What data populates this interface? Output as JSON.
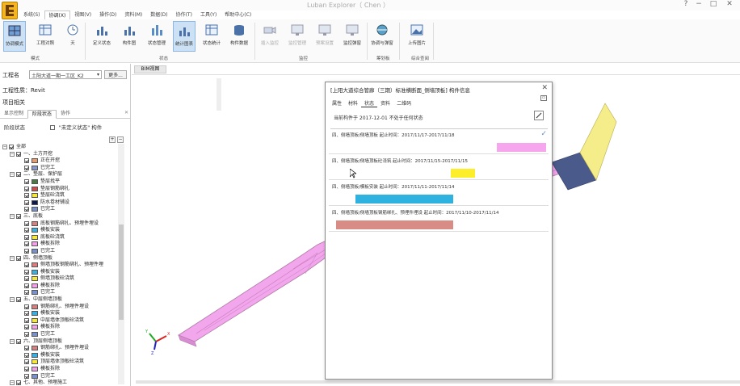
{
  "app": {
    "title": "Luban Explorer（ Chen ）",
    "window_controls": [
      "?",
      "−",
      "□",
      "✕"
    ]
  },
  "menu": [
    "系统(S)",
    "协调(X)",
    "视图(V)",
    "操作(D)",
    "资料(M)",
    "数据(D)",
    "协作(T)",
    "工具(Y)",
    "帮助中心(C)"
  ],
  "menu_active_index": 1,
  "ribbon": {
    "buttons": [
      {
        "label": "协调模式",
        "icon": "grid-icon",
        "selected": true,
        "dim": false
      },
      {
        "label": "工程对照",
        "icon": "table-icon",
        "selected": false,
        "dim": false
      },
      {
        "label": "天",
        "icon": "clock-icon",
        "selected": false,
        "dim": false
      },
      {
        "label": "定义状态",
        "icon": "chart-icon",
        "selected": false,
        "dim": false
      },
      {
        "label": "构件图",
        "icon": "chart-icon",
        "selected": false,
        "dim": false
      },
      {
        "label": "状态管理",
        "icon": "bars-icon",
        "selected": false,
        "dim": false
      },
      {
        "label": "统计图表",
        "icon": "chart-icon",
        "selected": true,
        "dim": false
      },
      {
        "label": "状态统计",
        "icon": "table-icon",
        "selected": false,
        "dim": false
      },
      {
        "label": "构件数据",
        "icon": "database-icon",
        "selected": false,
        "dim": false
      },
      {
        "label": "插入监控",
        "icon": "camera-icon",
        "selected": false,
        "dim": true
      },
      {
        "label": "监控管理",
        "icon": "monitor-icon",
        "selected": false,
        "dim": true
      },
      {
        "label": "预案设置",
        "icon": "monitor-icon",
        "selected": false,
        "dim": true
      },
      {
        "label": "监控弹窗",
        "icon": "monitor-icon",
        "selected": false,
        "dim": false
      },
      {
        "label": "协调与弹窗",
        "icon": "globe-icon",
        "selected": false,
        "dim": false
      },
      {
        "label": "上传图片",
        "icon": "image-icon",
        "selected": false,
        "dim": false
      }
    ],
    "groups": [
      "模式",
      "状态",
      "监控",
      "筹划板",
      "综合查阅"
    ]
  },
  "left_panel": {
    "project_label": "工程名",
    "project_value": "土阳大道一期一工区_K2",
    "more_button": "更多...",
    "project_property": "工程性质：Revit",
    "project_related": "项目相关",
    "tabs": [
      "显示控制",
      "阶段状态",
      "协作"
    ],
    "active_tab_index": 1,
    "filter_label": "阶段状态",
    "filter_option": "\"未定义状态\" 构件",
    "tree": [
      {
        "level": 0,
        "label": "全部",
        "color": "",
        "expander": "−"
      },
      {
        "level": 1,
        "label": "一、土方开挖",
        "color": "",
        "expander": "−"
      },
      {
        "level": 2,
        "label": "正在开挖",
        "color": "#e89a6a",
        "expander": ""
      },
      {
        "level": 2,
        "label": "已完工",
        "color": "#8899c8",
        "expander": ""
      },
      {
        "level": 1,
        "label": "二、垫层、保护层",
        "color": "",
        "expander": "−"
      },
      {
        "level": 2,
        "label": "垫层找平",
        "color": "#4a7a44",
        "expander": ""
      },
      {
        "level": 2,
        "label": "垫层钢筋绑扎",
        "color": "#c85050",
        "expander": ""
      },
      {
        "level": 2,
        "label": "垫层砼浇筑",
        "color": "#f5e83a",
        "expander": ""
      },
      {
        "level": 2,
        "label": "防水卷材铺设",
        "color": "#101850",
        "expander": ""
      },
      {
        "level": 2,
        "label": "已完工",
        "color": "#7a90c8",
        "expander": ""
      },
      {
        "level": 1,
        "label": "三、底板",
        "color": "",
        "expander": "−"
      },
      {
        "level": 2,
        "label": "底板钢筋绑扎、预埋件埋设",
        "color": "#d88080",
        "expander": ""
      },
      {
        "level": 2,
        "label": "模板安装",
        "color": "#3bb0e0",
        "expander": ""
      },
      {
        "level": 2,
        "label": "底板砼浇筑",
        "color": "#f5e83a",
        "expander": ""
      },
      {
        "level": 2,
        "label": "模板拆除",
        "color": "#f2a0e8",
        "expander": ""
      },
      {
        "level": 2,
        "label": "已完工",
        "color": "#7a90c8",
        "expander": ""
      },
      {
        "level": 1,
        "label": "四、侧墙顶板",
        "color": "",
        "expander": "−"
      },
      {
        "level": 2,
        "label": "侧墙顶板钢筋绑扎、预埋件埋",
        "color": "#d88080",
        "expander": ""
      },
      {
        "level": 2,
        "label": "模板安装",
        "color": "#3bb0e0",
        "expander": ""
      },
      {
        "level": 2,
        "label": "侧墙顶板砼浇筑",
        "color": "#f5e83a",
        "expander": ""
      },
      {
        "level": 2,
        "label": "模板拆除",
        "color": "#f2a0e8",
        "expander": ""
      },
      {
        "level": 2,
        "label": "已完工",
        "color": "#7a90c8",
        "expander": ""
      },
      {
        "level": 1,
        "label": "五、中层侧墙顶板",
        "color": "",
        "expander": "−"
      },
      {
        "level": 2,
        "label": "钢筋绑扎、预埋件埋设",
        "color": "#d88080",
        "expander": ""
      },
      {
        "level": 2,
        "label": "模板安装",
        "color": "#3bb0e0",
        "expander": ""
      },
      {
        "level": 2,
        "label": "中层墙体顶板砼浇筑",
        "color": "#f5e83a",
        "expander": ""
      },
      {
        "level": 2,
        "label": "模板拆除",
        "color": "#f2a0e8",
        "expander": ""
      },
      {
        "level": 2,
        "label": "已完工",
        "color": "#7a90c8",
        "expander": ""
      },
      {
        "level": 1,
        "label": "六、顶层侧墙顶板",
        "color": "",
        "expander": "−"
      },
      {
        "level": 2,
        "label": "钢筋绑扎、预埋件埋设",
        "color": "#d88080",
        "expander": ""
      },
      {
        "level": 2,
        "label": "模板安装",
        "color": "#3bb0e0",
        "expander": ""
      },
      {
        "level": 2,
        "label": "顶层墙体顶板砼浇筑",
        "color": "#f5e83a",
        "expander": ""
      },
      {
        "level": 2,
        "label": "模板拆除",
        "color": "#f2a0e8",
        "expander": ""
      },
      {
        "level": 2,
        "label": "已完工",
        "color": "#7a90c8",
        "expander": ""
      },
      {
        "level": 1,
        "label": "七、其他、预埋施工",
        "color": "",
        "expander": "−"
      }
    ]
  },
  "view": {
    "tab_label": "BIM视图",
    "model_color": "#f2a6ec",
    "end_block_color": "#4a5a8a",
    "end_cap_color": "#f5ec8a"
  },
  "dialog": {
    "title": "[上阳大道综合管廊（三期）标准横断面_侧墙顶板] 构件信息",
    "tabs": [
      "属性",
      "材料",
      "状态",
      "资料",
      "二维码"
    ],
    "active_tab_index": 2,
    "note": "当前构件于 2017-12-01 不处于任何状态",
    "stages": [
      {
        "text": "四、侧墙顶板/侧墙顶板   起止时间：2017/11/17-2017/11/18",
        "color": "#f5a6ec",
        "bar_from": 0.76,
        "bar_to": 0.99,
        "checked": true
      },
      {
        "text": "四、侧墙顶板/侧墙顶板砼浇筑   起止时间：2017/11/15-2017/11/15",
        "color": "#fcee2a",
        "bar_from": 0.55,
        "bar_to": 0.66,
        "checked": false
      },
      {
        "text": "四、侧墙顶板/模板安装   起止时间：2017/11/11-2017/11/14",
        "color": "#2fb2e0",
        "bar_from": 0.11,
        "bar_to": 0.56,
        "checked": false
      },
      {
        "text": "四、侧墙顶板/侧墙顶板钢筋绑扎、预埋件埋设   起止时间：2017/11/10-2017/11/14",
        "color": "#d88c86",
        "bar_from": 0.02,
        "bar_to": 0.56,
        "checked": false
      }
    ]
  }
}
